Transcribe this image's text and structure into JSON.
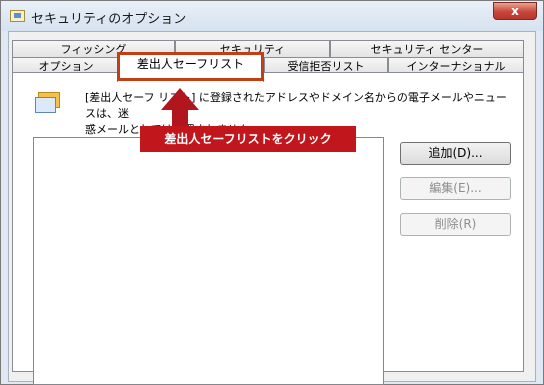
{
  "window": {
    "title": "セキュリティのオプション",
    "close_label": "x"
  },
  "tabs": {
    "row1": [
      "フィッシング",
      "セキュリティ",
      "セキュリティ センター"
    ],
    "row2": [
      "オプション",
      "差出人セーフリスト",
      "受信拒否リスト",
      "インターナショナル"
    ],
    "active": "差出人セーフリスト"
  },
  "description": {
    "line1": "[差出人セーフ リスト] に登録されたアドレスやドメイン名からの電子メールやニュースは、迷",
    "line2": "惑メールとしては処理されません。"
  },
  "buttons": {
    "add": "追加(D)...",
    "edit": "編集(E)...",
    "delete": "削除(R)"
  },
  "annotation": {
    "callout": "差出人セーフリストをクリック",
    "color": "#c0161c"
  }
}
